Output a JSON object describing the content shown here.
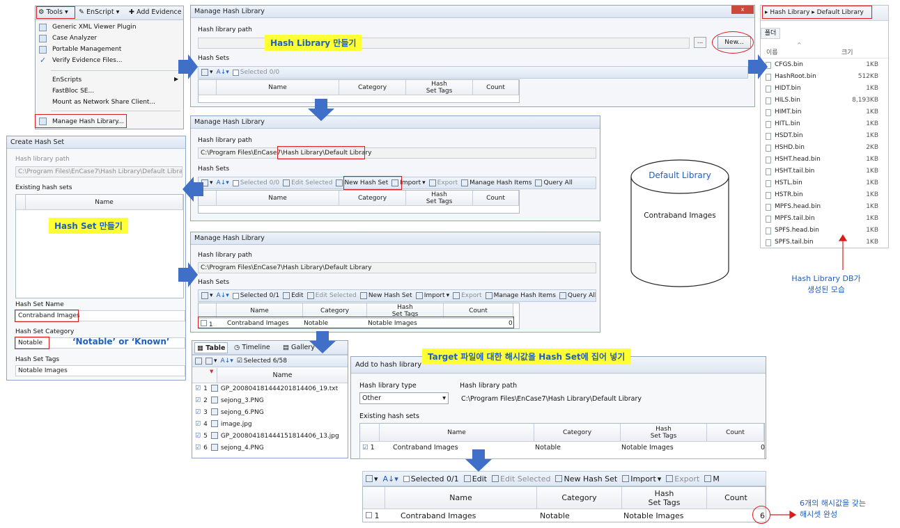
{
  "menu": {
    "tools": "Tools",
    "enscript": "EnScript",
    "add_evidence": "Add Evidence",
    "items": [
      "Generic XML Viewer Plugin",
      "Case Analyzer",
      "Portable Management",
      "Verify Evidence Files...",
      "EnScripts",
      "FastBloc SE...",
      "Mount as Network Share Client...",
      "Manage Hash Library..."
    ]
  },
  "w1": {
    "title": "Manage Hash Library",
    "path_label": "Hash library path",
    "new_btn": "New...",
    "browse": "...",
    "sets_label": "Hash Sets",
    "selected": "Selected 0/0",
    "cols": [
      "Name",
      "Category",
      "Hash\nSet Tags",
      "Count"
    ]
  },
  "w2": {
    "title": "Manage Hash Library",
    "path_label": "Hash library path",
    "path": "C:\\Program Files\\EnCase7\\Hash Library\\Default Library",
    "sets_label": "Hash Sets",
    "tb": [
      "Selected 0/0",
      "Edit Selected",
      "New Hash Set",
      "Import",
      "Export",
      "Manage Hash Items",
      "Query All"
    ],
    "cols": [
      "Name",
      "Category",
      "Hash\nSet Tags",
      "Count"
    ]
  },
  "w3": {
    "title": "Manage Hash Library",
    "path_label": "Hash library path",
    "path": "C:\\Program Files\\EnCase7\\Hash Library\\Default Library",
    "sets_label": "Hash Sets",
    "tb": [
      "Selected 0/1",
      "Edit",
      "Edit Selected",
      "New Hash Set",
      "Import",
      "Export",
      "Manage Hash Items",
      "Query All"
    ],
    "cols": [
      "Name",
      "Category",
      "Hash\nSet Tags",
      "Count"
    ],
    "row": {
      "num": "1",
      "name": "Contraband Images",
      "category": "Notable",
      "tags": "Notable Images",
      "count": "0"
    }
  },
  "create": {
    "title": "Create Hash Set",
    "path_label": "Hash library path",
    "path": "C:\\Program Files\\EnCase7\\Hash Library\\Default Library",
    "existing": "Existing hash sets",
    "col": "Name",
    "name_label": "Hash Set Name",
    "name": "Contraband Images",
    "cat_label": "Hash Set Category",
    "cat": "Notable",
    "tags_label": "Hash Set Tags",
    "tags": "Notable Images"
  },
  "explorer": {
    "crumb1": "Hash Library",
    "crumb2": "Default Library",
    "tab": "폴더",
    "col_name": "이름",
    "col_size": "크기",
    "files": [
      [
        "CFGS.bin",
        "1KB"
      ],
      [
        "HashRoot.bin",
        "512KB"
      ],
      [
        "HIDT.bin",
        "1KB"
      ],
      [
        "HILS.bin",
        "8,193KB"
      ],
      [
        "HIMT.bin",
        "1KB"
      ],
      [
        "HITL.bin",
        "1KB"
      ],
      [
        "HSDT.bin",
        "1KB"
      ],
      [
        "HSHD.bin",
        "2KB"
      ],
      [
        "HSHT.head.bin",
        "1KB"
      ],
      [
        "HSHT.tail.bin",
        "1KB"
      ],
      [
        "HSTL.bin",
        "1KB"
      ],
      [
        "HSTR.bin",
        "1KB"
      ],
      [
        "MPFS.head.bin",
        "1KB"
      ],
      [
        "MPFS.tail.bin",
        "1KB"
      ],
      [
        "SPFS.head.bin",
        "1KB"
      ],
      [
        "SPFS.tail.bin",
        "1KB"
      ]
    ]
  },
  "cylinder": {
    "top": "Default Library",
    "body": "Contraband Images"
  },
  "table": {
    "tabs": [
      "Table",
      "Timeline",
      "Gallery"
    ],
    "selected": "Selected 6/58",
    "col": "Name",
    "rows": [
      [
        "1",
        "GP_20080418144420181440​6_19.txt"
      ],
      [
        "2",
        "sejong_3.PNG"
      ],
      [
        "3",
        "sejong_6.PNG"
      ],
      [
        "4",
        "image.jpg"
      ],
      [
        "5",
        "GP_20080418144415181440​6_13.jpg"
      ],
      [
        "6",
        "sejong_4.PNG"
      ]
    ]
  },
  "add": {
    "title": "Add to hash library",
    "type_label": "Hash library type",
    "type": "Other",
    "path_label": "Hash library path",
    "path": "C:\\Program Files\\EnCase7\\Hash Library\\Default Library",
    "existing": "Existing hash sets",
    "cols": [
      "Name",
      "Category",
      "Hash\nSet Tags",
      "Count"
    ],
    "row": {
      "num": "1",
      "name": "Contraband Images",
      "category": "Notable",
      "tags": "Notable Images",
      "count": "0"
    }
  },
  "final": {
    "tb": [
      "Selected 0/1",
      "Edit",
      "Edit Selected",
      "New Hash Set",
      "Import",
      "Export",
      "M"
    ],
    "cols": [
      "Name",
      "Category",
      "Hash\nSet Tags",
      "Count"
    ],
    "row": {
      "num": "1",
      "name": "Contraband Images",
      "category": "Notable",
      "tags": "Notable Images",
      "count": "6"
    }
  },
  "captions": {
    "make_lib": "Hash Library 만들기",
    "make_set": "Hash Set 만들기",
    "notable": "‘Notable’ or ‘Known’",
    "target": "Target 파일에 대한 해시값을 Hash Set에 집어 넣기",
    "db_created": "Hash Library DB가\n생성된 모습",
    "done": "6개의 해시값을 갖는\n해시셋 완성"
  }
}
